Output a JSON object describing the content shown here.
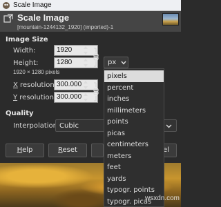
{
  "window": {
    "title": "Scale Image",
    "icon": "gimp-app-icon"
  },
  "header": {
    "title": "Scale Image",
    "subtitle": "[mountain-1244132_1920] (imported)-1",
    "icon": "scale-image-icon"
  },
  "image_size": {
    "section_label": "Image Size",
    "width_label": "Width:",
    "width_value": "1920",
    "height_label": "Height:",
    "height_value": "1280",
    "pixel_info": "1920 × 1280 pixels",
    "unit_value": "px",
    "x_res_label": "X resolution:",
    "x_res_value": "300.000",
    "y_res_label": "Y resolution:",
    "y_res_value": "300.000"
  },
  "quality": {
    "section_label": "Quality",
    "interp_label": "Interpolation:",
    "interp_value": "Cubic"
  },
  "buttons": {
    "help": "Help",
    "reset": "Reset",
    "cancel": "Cancel"
  },
  "unit_menu": {
    "items": [
      "pixels",
      "percent",
      "inches",
      "millimeters",
      "points",
      "picas",
      "centimeters",
      "meters",
      "feet",
      "yards",
      "typogr. points",
      "typogr. picas"
    ],
    "selected": "pixels"
  },
  "watermark": "wsxdn.com",
  "colors": {
    "dialog_bg": "#2b2b2b",
    "header_bg": "#454545",
    "input_bg": "#e8e8e8",
    "menu_selected_bg": "#dcdcdc"
  }
}
